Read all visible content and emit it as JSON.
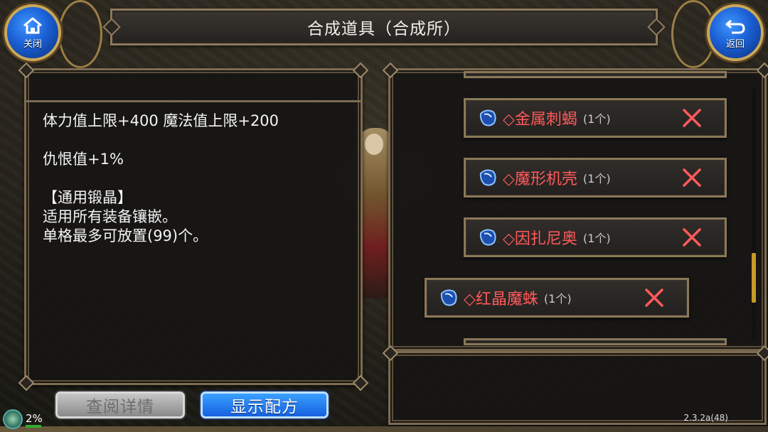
{
  "header": {
    "title": "合成道具（合成所）",
    "close_label": "关闭",
    "back_label": "返回"
  },
  "description": {
    "lines": [
      "体力值上限+400 魔法值上限+200",
      "",
      "仇恨值+1%",
      "",
      "【通用锻晶】",
      "适用所有装备镶嵌。",
      "单格最多可放置(99)个。"
    ]
  },
  "items": [
    {
      "name": "◇金属刺蝎",
      "count": "(1个)"
    },
    {
      "name": "◇魔形机壳",
      "count": "(1个)"
    },
    {
      "name": "◇因扎尼奥",
      "count": "(1个)"
    },
    {
      "name": "◇红晶魔蛛",
      "count": "(1个)"
    }
  ],
  "buttons": {
    "details": "查阅详情",
    "recipe": "显示配方"
  },
  "status": {
    "percent": "2%",
    "version": "2.3.2a(48)"
  },
  "scroll": {
    "position_fraction": 0.65
  },
  "colors": {
    "item_name": "#ff5a5a",
    "accent_blue": "#1a5fd4",
    "scroll_thumb": "#c79a2a",
    "panel_border": "#7d6c52"
  },
  "icons": [
    "home-icon",
    "back-arrow-icon",
    "gem-icon",
    "close-x-icon",
    "status-orb-icon"
  ]
}
